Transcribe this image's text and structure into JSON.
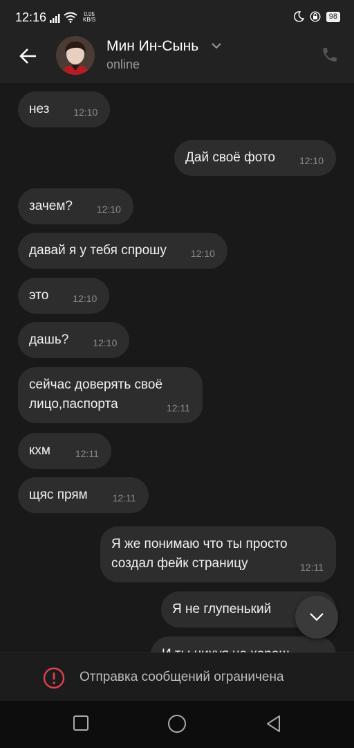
{
  "status_bar": {
    "time": "12:16",
    "speed_value": "0.05",
    "speed_unit": "KB/S",
    "battery": "98"
  },
  "header": {
    "contact_name": "Мин Ин-Сынь",
    "contact_status": "online"
  },
  "messages": [
    {
      "side": "in",
      "text": "нез",
      "time": "12:10"
    },
    {
      "side": "out",
      "text": "Дай своё фото",
      "time": "12:10"
    },
    {
      "side": "in",
      "text": "зачем?",
      "time": "12:10"
    },
    {
      "side": "in",
      "text": "давай я у тебя спрошу",
      "time": "12:10"
    },
    {
      "side": "in",
      "text": "это",
      "time": "12:10"
    },
    {
      "side": "in",
      "text": "дашь?",
      "time": "12:10"
    },
    {
      "side": "in",
      "text": "сейчас доверять своё\nлицо,паспорта",
      "time": "12:11"
    },
    {
      "side": "in",
      "text": "кхм",
      "time": "12:11"
    },
    {
      "side": "in",
      "text": "щяс прям",
      "time": "12:11"
    },
    {
      "side": "out",
      "text": "Я же понимаю что ты просто\nсоздал фейк страницу",
      "time": "12:11"
    },
    {
      "side": "out",
      "text": "Я не глупенький",
      "time": ""
    },
    {
      "side": "out",
      "text": "И ты нихуя не хорош",
      "time": ""
    }
  ],
  "footer": {
    "restriction_text": "Отправка сообщений ограничена"
  },
  "colors": {
    "background": "#191919",
    "bubble": "#2d2d2d",
    "warning": "#e0414e"
  }
}
